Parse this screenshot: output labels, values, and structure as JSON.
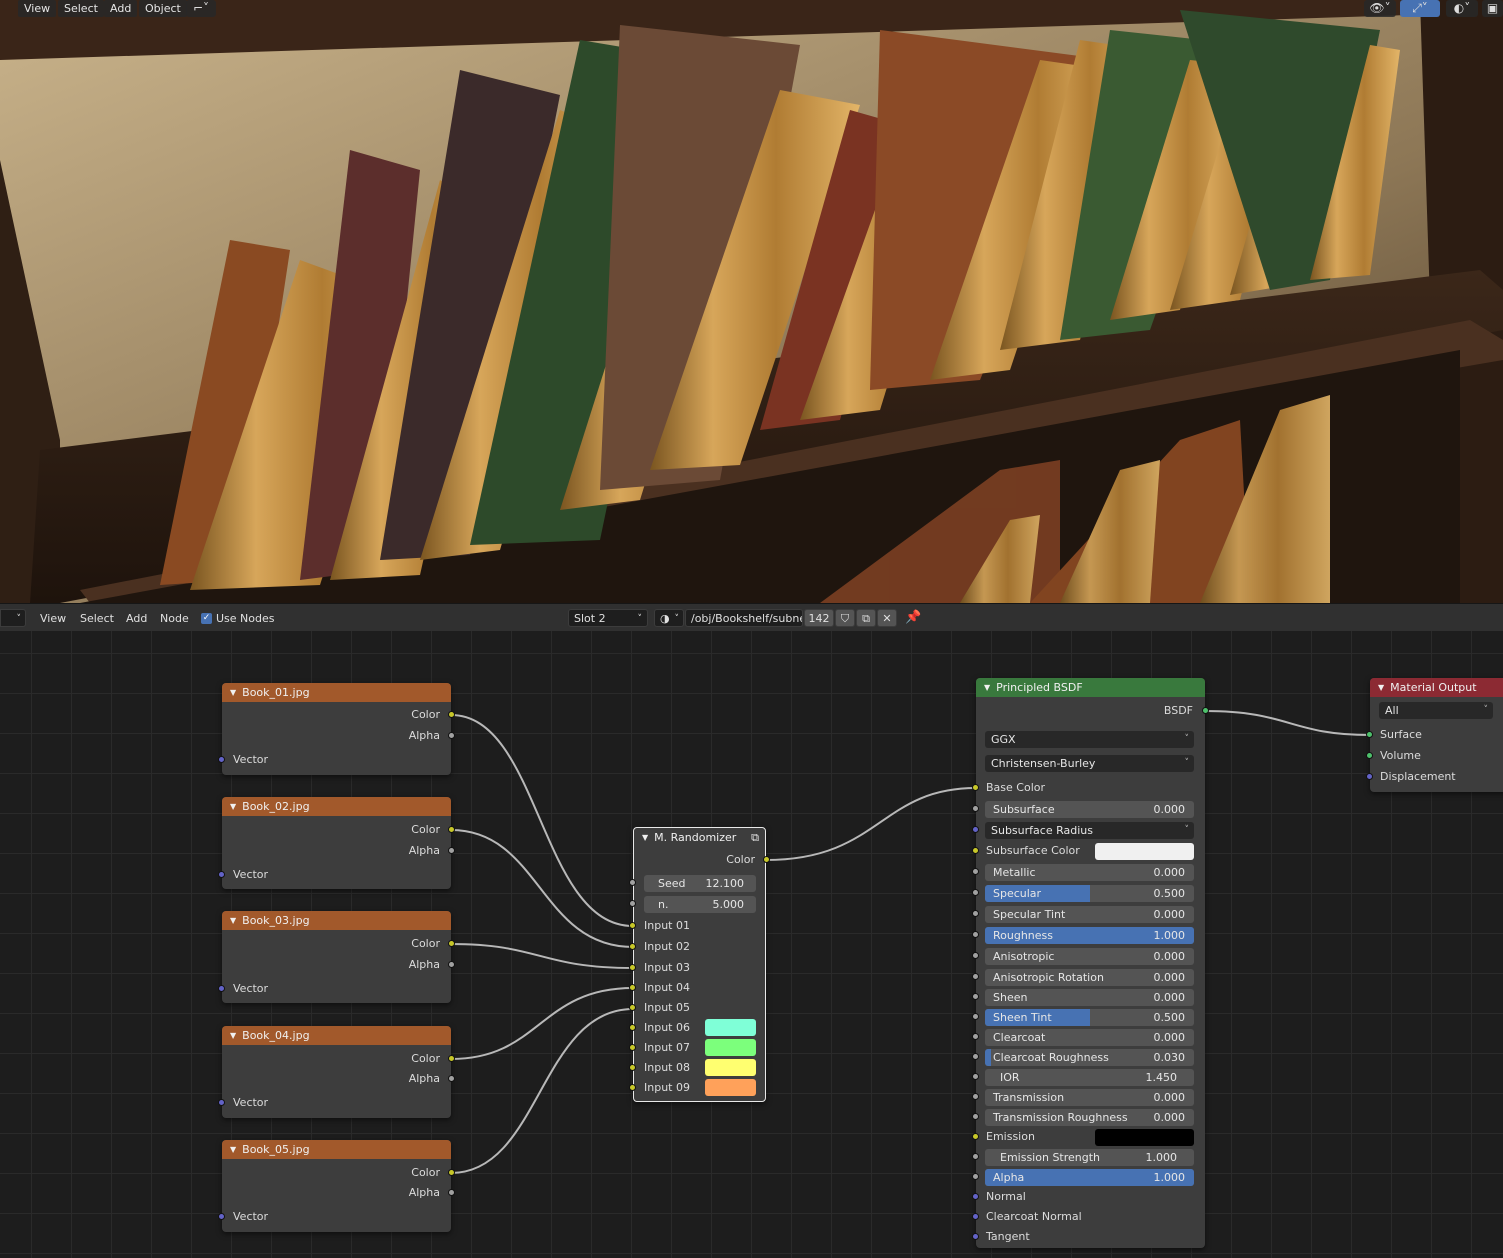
{
  "viewport": {
    "menu": [
      "View",
      "Select",
      "Add",
      "Object"
    ]
  },
  "node_editor": {
    "menu": [
      "View",
      "Select",
      "Add",
      "Node"
    ],
    "use_nodes_label": "Use Nodes",
    "use_nodes_checked": true,
    "slot": "Slot 2",
    "material_path": "/obj/Bookshelf/subne...",
    "user_count": "142"
  },
  "image_nodes": [
    {
      "title": "Book_01.jpg",
      "out_color": "Color",
      "out_alpha": "Alpha",
      "in_vector": "Vector"
    },
    {
      "title": "Book_02.jpg",
      "out_color": "Color",
      "out_alpha": "Alpha",
      "in_vector": "Vector"
    },
    {
      "title": "Book_03.jpg",
      "out_color": "Color",
      "out_alpha": "Alpha",
      "in_vector": "Vector"
    },
    {
      "title": "Book_04.jpg",
      "out_color": "Color",
      "out_alpha": "Alpha",
      "in_vector": "Vector"
    },
    {
      "title": "Book_05.jpg",
      "out_color": "Color",
      "out_alpha": "Alpha",
      "in_vector": "Vector"
    }
  ],
  "randomizer": {
    "title": "M. Randomizer",
    "out_color": "Color",
    "seed_label": "Seed",
    "seed_value": "12.100",
    "n_label": "n.",
    "n_value": "5.000",
    "inputs": [
      "Input 01",
      "Input 02",
      "Input 03",
      "Input 04",
      "Input 05",
      "Input 06",
      "Input 07",
      "Input 08",
      "Input 09"
    ],
    "swatches": [
      "#7fffd7",
      "#7cff7c",
      "#ffff70",
      "#ffa15a"
    ]
  },
  "bsdf": {
    "title": "Principled BSDF",
    "out": "BSDF",
    "distribution": "GGX",
    "subsurface_method": "Christensen-Burley",
    "base_color": "Base Color",
    "subsurface_radius": "Subsurface Radius",
    "subsurface_color_label": "Subsurface Color",
    "subsurface_color": "#f0f0f0",
    "emission_label": "Emission",
    "emission_color": "#000000",
    "normal": "Normal",
    "clearcoat_normal": "Clearcoat Normal",
    "tangent": "Tangent",
    "params": [
      {
        "label": "Subsurface",
        "value": "0.000",
        "fraction": 0
      },
      {
        "label": "Metallic",
        "value": "0.000",
        "fraction": 0
      },
      {
        "label": "Specular",
        "value": "0.500",
        "fraction": 0.5
      },
      {
        "label": "Specular Tint",
        "value": "0.000",
        "fraction": 0
      },
      {
        "label": "Roughness",
        "value": "1.000",
        "fraction": 1
      },
      {
        "label": "Anisotropic",
        "value": "0.000",
        "fraction": 0
      },
      {
        "label": "Anisotropic Rotation",
        "value": "0.000",
        "fraction": 0
      },
      {
        "label": "Sheen",
        "value": "0.000",
        "fraction": 0
      },
      {
        "label": "Sheen Tint",
        "value": "0.500",
        "fraction": 0.5
      },
      {
        "label": "Clearcoat",
        "value": "0.000",
        "fraction": 0
      },
      {
        "label": "Clearcoat Roughness",
        "value": "0.030",
        "fraction": 0.03
      },
      {
        "label": "IOR",
        "value": "1.450",
        "fraction": 0
      },
      {
        "label": "Transmission",
        "value": "0.000",
        "fraction": 0
      },
      {
        "label": "Transmission Roughness",
        "value": "0.000",
        "fraction": 0
      },
      {
        "label": "Emission Strength",
        "value": "1.000",
        "fraction": 0
      },
      {
        "label": "Alpha",
        "value": "1.000",
        "fraction": 1
      }
    ]
  },
  "material_output": {
    "title": "Material Output",
    "target": "All",
    "inputs": [
      "Surface",
      "Volume",
      "Displacement"
    ]
  },
  "colors": {
    "image_header": "#a2592b",
    "bsdf_header": "#39793d",
    "output_header": "#8c2a33",
    "slider_fill": "#4772b3"
  }
}
